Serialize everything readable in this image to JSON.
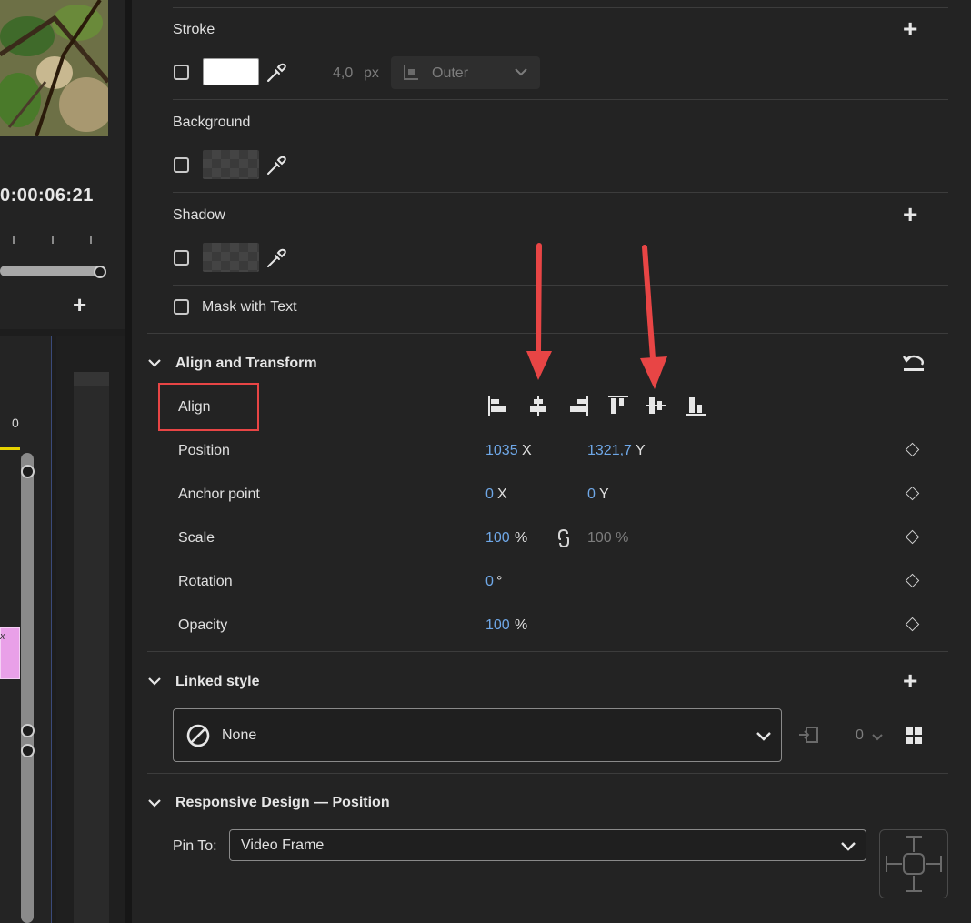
{
  "left": {
    "timecode": "0:00:06:21",
    "track_value": "0",
    "clip_mark": "x",
    "add_symbol": "+"
  },
  "stroke": {
    "title": "Stroke",
    "width_value": "4,0",
    "width_unit": "px",
    "position_option": "Outer",
    "add_symbol": "+"
  },
  "background": {
    "title": "Background"
  },
  "shadow": {
    "title": "Shadow",
    "add_symbol": "+"
  },
  "mask": {
    "label": "Mask with Text"
  },
  "align_transform": {
    "title": "Align and Transform",
    "align_label": "Align",
    "position": {
      "label": "Position",
      "x": "1035",
      "x_axis": "X",
      "y": "1321,7",
      "y_axis": "Y"
    },
    "anchor": {
      "label": "Anchor point",
      "x": "0",
      "x_axis": "X",
      "y": "0",
      "y_axis": "Y"
    },
    "scale": {
      "label": "Scale",
      "value": "100",
      "unit": "%",
      "value2": "100 %"
    },
    "rotation": {
      "label": "Rotation",
      "value": "0",
      "unit": "°"
    },
    "opacity": {
      "label": "Opacity",
      "value": "100",
      "unit": "%"
    }
  },
  "linked_style": {
    "title": "Linked style",
    "selected": "None",
    "count": "0",
    "add_symbol": "+"
  },
  "responsive": {
    "title": "Responsive Design — Position",
    "pin_label": "Pin To:",
    "pin_value": "Video Frame"
  },
  "colors": {
    "accent_blue": "#6fa8e8",
    "annotation_red": "#e84545",
    "panel_bg": "#232323"
  }
}
